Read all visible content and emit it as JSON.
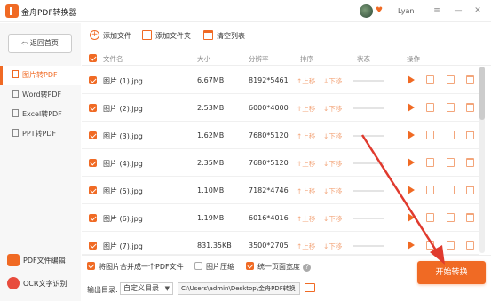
{
  "app": {
    "title": "金舟PDF转换器",
    "username": "Lyan"
  },
  "window_buttons": {
    "menu": "≡",
    "minimize": "—",
    "close": "✕"
  },
  "sidebar": {
    "back_label": "返回首页",
    "items": [
      {
        "label": "图片转PDF",
        "active": true
      },
      {
        "label": "Word转PDF",
        "active": false
      },
      {
        "label": "Excel转PDF",
        "active": false
      },
      {
        "label": "PPT转PDF",
        "active": false
      }
    ],
    "tools": [
      {
        "label": "PDF文件编辑",
        "color": "#f06a24"
      },
      {
        "label": "OCR文字识别",
        "color": "#e84c3d"
      }
    ]
  },
  "toolbar": {
    "add_file": "添加文件",
    "add_folder": "添加文件夹",
    "clear_list": "清空列表"
  },
  "table": {
    "headers": {
      "name": "文件名",
      "size": "大小",
      "resolution": "分辨率",
      "order": "排序",
      "status": "状态",
      "action": "操作"
    },
    "move_up": "上移",
    "move_down": "下移",
    "rows": [
      {
        "name": "图片 (1).jpg",
        "size": "6.67MB",
        "resolution": "8192*5461"
      },
      {
        "name": "图片 (2).jpg",
        "size": "2.53MB",
        "resolution": "6000*4000"
      },
      {
        "name": "图片 (3).jpg",
        "size": "1.62MB",
        "resolution": "7680*5120"
      },
      {
        "name": "图片 (4).jpg",
        "size": "2.35MB",
        "resolution": "7680*5120"
      },
      {
        "name": "图片 (5).jpg",
        "size": "1.10MB",
        "resolution": "7182*4746"
      },
      {
        "name": "图片 (6).jpg",
        "size": "1.19MB",
        "resolution": "6016*4016"
      },
      {
        "name": "图片 (7).jpg",
        "size": "831.35KB",
        "resolution": "3500*2705"
      }
    ]
  },
  "options": {
    "merge": {
      "label": "将图片合并成一个PDF文件",
      "checked": true
    },
    "compress": {
      "label": "图片压缩",
      "checked": false
    },
    "unify_width": {
      "label": "统一页面宽度",
      "checked": true
    }
  },
  "output": {
    "label": "输出目录:",
    "mode": "自定义目录",
    "path": "C:\\Users\\admin\\Desktop\\金舟PDF转换"
  },
  "start_button": "开始转换",
  "colors": {
    "accent": "#f06a24",
    "arrow": "#e03a2e"
  }
}
